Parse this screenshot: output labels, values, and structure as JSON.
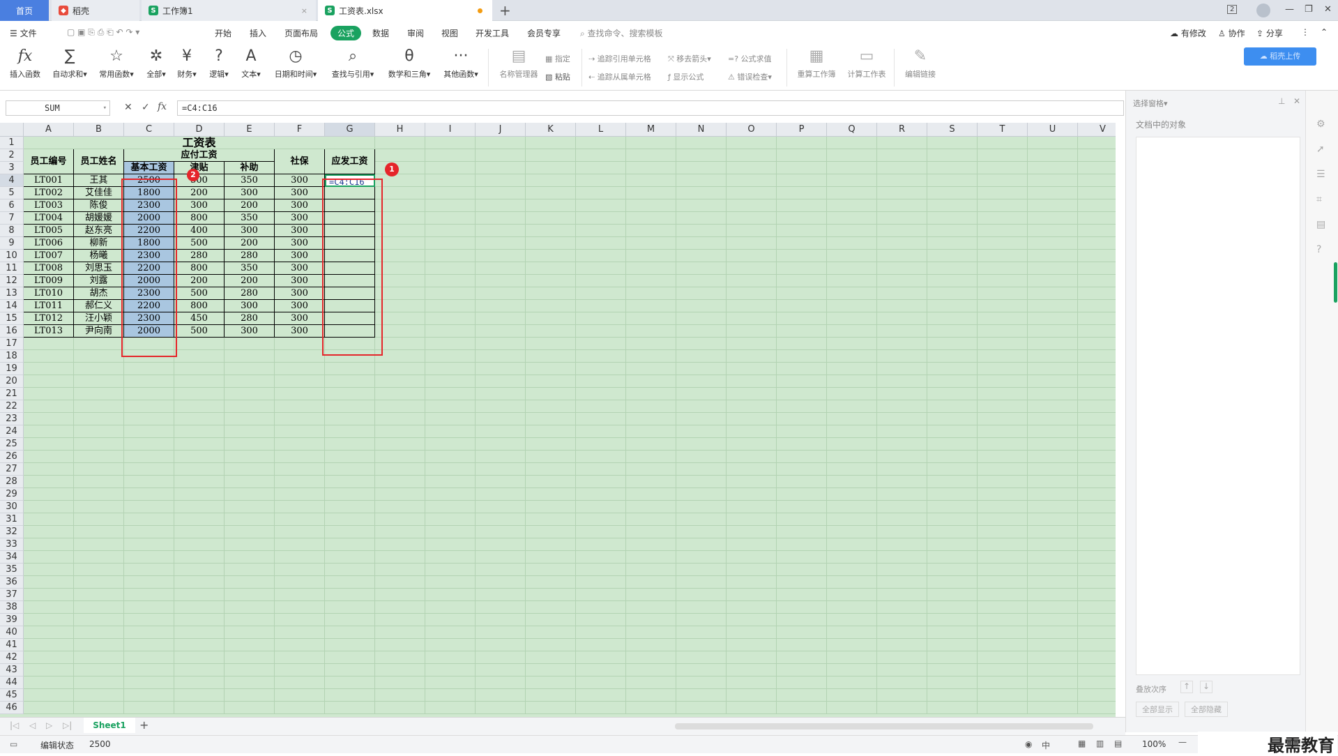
{
  "tabs": {
    "home": "首页",
    "t1": "稻壳",
    "t2": "工作簿1",
    "t3": "工资表.xlsx",
    "t2_close": "×",
    "add": "+"
  },
  "window": {
    "badge": "2"
  },
  "menu": {
    "file": "☰ 文件",
    "items": [
      "开始",
      "插入",
      "页面布局",
      "公式",
      "数据",
      "审阅",
      "视图",
      "开发工具",
      "会员专享"
    ],
    "search": "查找命令、搜索模板",
    "right": [
      "有修改",
      "协作",
      "分享"
    ]
  },
  "ribbon": {
    "buttons": [
      {
        "icon": "fx",
        "label": "插入函数"
      },
      {
        "icon": "∑",
        "label": "自动求和▾"
      },
      {
        "icon": "☆",
        "label": "常用函数▾"
      },
      {
        "icon": "✲",
        "label": "全部▾"
      },
      {
        "icon": "¥",
        "label": "财务▾"
      },
      {
        "icon": "?",
        "label": "逻辑▾"
      },
      {
        "icon": "A",
        "label": "文本▾"
      },
      {
        "icon": "◷",
        "label": "日期和时间▾"
      },
      {
        "icon": "⌕",
        "label": "查找与引用▾"
      },
      {
        "icon": "θ",
        "label": "数学和三角▾"
      },
      {
        "icon": "···",
        "label": "其他函数▾"
      }
    ],
    "name_mgr": "名称管理器",
    "specify": "指定",
    "paste": "粘贴",
    "trace_prec": "追踪引用单元格",
    "trace_dep": "追踪从属单元格",
    "remove_arrows": "移去箭头▾",
    "show_formula": "显示公式",
    "eval_formula": "=? 公式求值",
    "error_check": "错误检查▾",
    "recalc_wb": "重算工作簿",
    "calc_ws": "计算工作表",
    "edit_links": "编辑链接",
    "cloud_btn": "稻壳上传"
  },
  "formula_bar": {
    "name_box": "SUM",
    "formula": "=C4:C16",
    "fx": "fx"
  },
  "grid": {
    "columns": [
      "A",
      "B",
      "C",
      "D",
      "E",
      "F",
      "G",
      "H",
      "I",
      "J",
      "K",
      "L",
      "M",
      "N",
      "O",
      "P",
      "Q",
      "R",
      "S",
      "T",
      "U",
      "V"
    ],
    "rows": [
      "1",
      "2",
      "3",
      "4",
      "5",
      "6",
      "7",
      "8",
      "9",
      "10",
      "11",
      "12",
      "13",
      "14",
      "15",
      "16",
      "17",
      "18",
      "19",
      "20",
      "21",
      "22",
      "23",
      "24",
      "25",
      "26",
      "27",
      "28",
      "29",
      "30",
      "31",
      "32",
      "33",
      "34",
      "35",
      "36",
      "37",
      "38",
      "39",
      "40",
      "41",
      "42",
      "43",
      "44",
      "45",
      "46"
    ],
    "title": "工资表",
    "headers": {
      "id": "员工编号",
      "name": "员工姓名",
      "payable": "应付工资",
      "base": "基本工资",
      "allowance": "津贴",
      "subsidy": "补助",
      "social": "社保",
      "net": "应发工资"
    },
    "records": [
      [
        "LT001",
        "王其",
        "2500",
        "500",
        "350",
        "300"
      ],
      [
        "LT002",
        "艾佳佳",
        "1800",
        "200",
        "300",
        "300"
      ],
      [
        "LT003",
        "陈俊",
        "2300",
        "300",
        "200",
        "300"
      ],
      [
        "LT004",
        "胡媛媛",
        "2000",
        "800",
        "350",
        "300"
      ],
      [
        "LT005",
        "赵东亮",
        "2200",
        "400",
        "300",
        "300"
      ],
      [
        "LT006",
        "柳新",
        "1800",
        "500",
        "200",
        "300"
      ],
      [
        "LT007",
        "杨曦",
        "2300",
        "280",
        "280",
        "300"
      ],
      [
        "LT008",
        "刘思玉",
        "2200",
        "800",
        "350",
        "300"
      ],
      [
        "LT009",
        "刘露",
        "2000",
        "200",
        "200",
        "300"
      ],
      [
        "LT010",
        "胡杰",
        "2300",
        "500",
        "280",
        "300"
      ],
      [
        "LT011",
        "郝仁义",
        "2200",
        "800",
        "300",
        "300"
      ],
      [
        "LT012",
        "汪小颖",
        "2300",
        "450",
        "280",
        "300"
      ],
      [
        "LT013",
        "尹向南",
        "2000",
        "500",
        "300",
        "300"
      ]
    ],
    "edit_cell": "=C4:C16"
  },
  "annotations": {
    "one": "1",
    "two": "2"
  },
  "right_pane": {
    "title": "选择窗格▾",
    "subtitle": "文档中的对象",
    "order": "叠放次序",
    "show_all": "全部显示",
    "hide_all": "全部隐藏"
  },
  "sheet_tabs": {
    "sheet1": "Sheet1",
    "add": "+"
  },
  "status": {
    "mode": "编辑状态",
    "value": "2500",
    "zoom": "100%",
    "ime": "中",
    "watermark": "最需教育"
  },
  "colors": {
    "accent": "#1aa260",
    "grid_bg": "#cfe8cf",
    "highlight": "#e5252a",
    "selection": "#a9c6e0"
  }
}
